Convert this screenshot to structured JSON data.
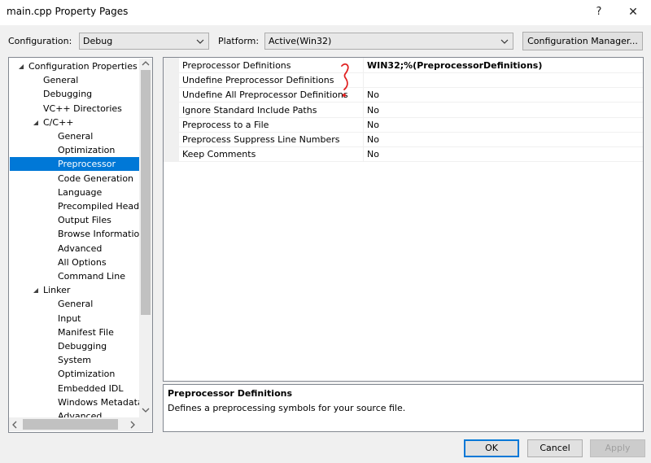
{
  "window": {
    "title": "main.cpp Property Pages",
    "help_glyph": "?",
    "close_glyph": "✕"
  },
  "config": {
    "configuration_label": "Configuration:",
    "configuration_value": "Debug",
    "platform_label": "Platform:",
    "platform_value": "Active(Win32)",
    "manager_button": "Configuration Manager..."
  },
  "tree": {
    "items": [
      {
        "label": "Configuration Properties",
        "level": 0,
        "expanded": true
      },
      {
        "label": "General",
        "level": 1
      },
      {
        "label": "Debugging",
        "level": 1
      },
      {
        "label": "VC++ Directories",
        "level": 1
      },
      {
        "label": "C/C++",
        "level": 1,
        "expanded": true
      },
      {
        "label": "General",
        "level": 2
      },
      {
        "label": "Optimization",
        "level": 2
      },
      {
        "label": "Preprocessor",
        "level": 2,
        "selected": true
      },
      {
        "label": "Code Generation",
        "level": 2
      },
      {
        "label": "Language",
        "level": 2
      },
      {
        "label": "Precompiled Heade",
        "level": 2
      },
      {
        "label": "Output Files",
        "level": 2
      },
      {
        "label": "Browse Information",
        "level": 2
      },
      {
        "label": "Advanced",
        "level": 2
      },
      {
        "label": "All Options",
        "level": 2
      },
      {
        "label": "Command Line",
        "level": 2
      },
      {
        "label": "Linker",
        "level": 1,
        "expanded": true
      },
      {
        "label": "General",
        "level": 2
      },
      {
        "label": "Input",
        "level": 2
      },
      {
        "label": "Manifest File",
        "level": 2
      },
      {
        "label": "Debugging",
        "level": 2
      },
      {
        "label": "System",
        "level": 2
      },
      {
        "label": "Optimization",
        "level": 2
      },
      {
        "label": "Embedded IDL",
        "level": 2
      },
      {
        "label": "Windows Metadata",
        "level": 2
      },
      {
        "label": "Advanced",
        "level": 2
      }
    ]
  },
  "properties": {
    "rows": [
      {
        "name": "Preprocessor Definitions",
        "value": "WIN32;%(PreprocessorDefinitions)",
        "bold": true
      },
      {
        "name": "Undefine Preprocessor Definitions",
        "value": ""
      },
      {
        "name": "Undefine All Preprocessor Definitions",
        "value": "No"
      },
      {
        "name": "Ignore Standard Include Paths",
        "value": "No"
      },
      {
        "name": "Preprocess to a File",
        "value": "No"
      },
      {
        "name": "Preprocess Suppress Line Numbers",
        "value": "No"
      },
      {
        "name": "Keep Comments",
        "value": "No"
      }
    ]
  },
  "description": {
    "title": "Preprocessor Definitions",
    "text": "Defines a preprocessing symbols for your source file."
  },
  "buttons": {
    "ok": "OK",
    "cancel": "Cancel",
    "apply": "Apply"
  },
  "colors": {
    "selection": "#0078d7",
    "annotation": "#e02020"
  }
}
